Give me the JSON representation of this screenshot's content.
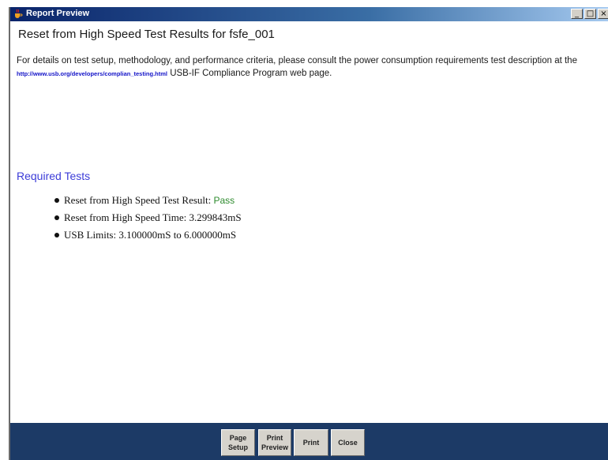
{
  "window": {
    "title": "Report Preview",
    "controls": {
      "minimize": "_",
      "maximize": "□",
      "close": "×"
    }
  },
  "report": {
    "heading": "Reset from High Speed Test Results for fsfe_001",
    "description_before": "For details on test setup, methodology, and performance criteria, please consult the power consumption requirements test description at the ",
    "link_text": "http://www.usb.org/developers/complian_testing.html",
    "description_after": " USB-IF Compliance Program web page.",
    "section_title": "Required Tests",
    "tests": [
      {
        "label": "Reset from High Speed Test Result: ",
        "value": "Pass"
      },
      {
        "label": "Reset from High Speed Time: 3.299843mS",
        "value": ""
      },
      {
        "label": "USB Limits: 3.100000mS to 6.000000mS",
        "value": ""
      }
    ]
  },
  "buttons": {
    "page_setup_1": "Page",
    "page_setup_2": "Setup",
    "print_preview_1": "Print",
    "print_preview_2": "Preview",
    "print": "Print",
    "close": "Close"
  },
  "colors": {
    "pass": "#2e8b2e",
    "section": "#3c3cd8",
    "link": "#1414c8",
    "bottom_bar": "#1c3a66"
  },
  "icons": {
    "title_icon": "java-cup-icon"
  }
}
